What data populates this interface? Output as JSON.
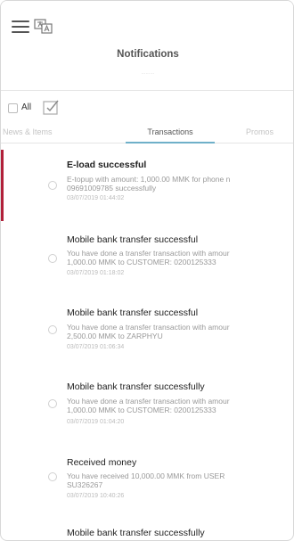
{
  "header": {
    "title": "Notifications",
    "subtitle": "·········"
  },
  "select_row": {
    "all_label": "All"
  },
  "tabs": [
    {
      "label": "News & Items",
      "active": false
    },
    {
      "label": "Transactions",
      "active": true
    },
    {
      "label": "Promos",
      "active": false
    }
  ],
  "notifications": [
    {
      "title": "E-load successful",
      "body_line1": "E-topup with amount: 1,000.00 MMK for phone n",
      "body_line2": "09691009785 successfully",
      "date": "03/07/2019 01:44:02",
      "unread": true
    },
    {
      "title": "Mobile bank transfer successful",
      "body_line1": "You have done a transfer transaction with amour",
      "body_line2": "1,000.00 MMK to CUSTOMER: 0200125333",
      "date": "03/07/2019 01:18:02",
      "unread": false
    },
    {
      "title": "Mobile bank transfer successful",
      "body_line1": "You have done a transfer transaction with amour",
      "body_line2": "2,500.00 MMK to ZARPHYU",
      "date": "03/07/2019 01:06:34",
      "unread": false
    },
    {
      "title": "Mobile bank transfer successfully",
      "body_line1": "You have done a transfer transaction with amour",
      "body_line2": "1,000.00 MMK to CUSTOMER: 0200125333",
      "date": "03/07/2019 01:04:20",
      "unread": false
    },
    {
      "title": "Received money",
      "body_line1": "You have received 10,000.00 MMK from USER",
      "body_line2": "SU326267",
      "date": "03/07/2019 10:40:26",
      "unread": false
    },
    {
      "title": "Mobile bank transfer successfully",
      "body_line1": "",
      "body_line2": "",
      "date": "",
      "unread": false
    }
  ],
  "colors": {
    "unread_bar": "#b1203a",
    "tab_underline": "#6fb0c9"
  },
  "icons": {
    "menu": "hamburger-icon",
    "language": "translate-icon",
    "select": "checkbox-check-icon"
  }
}
